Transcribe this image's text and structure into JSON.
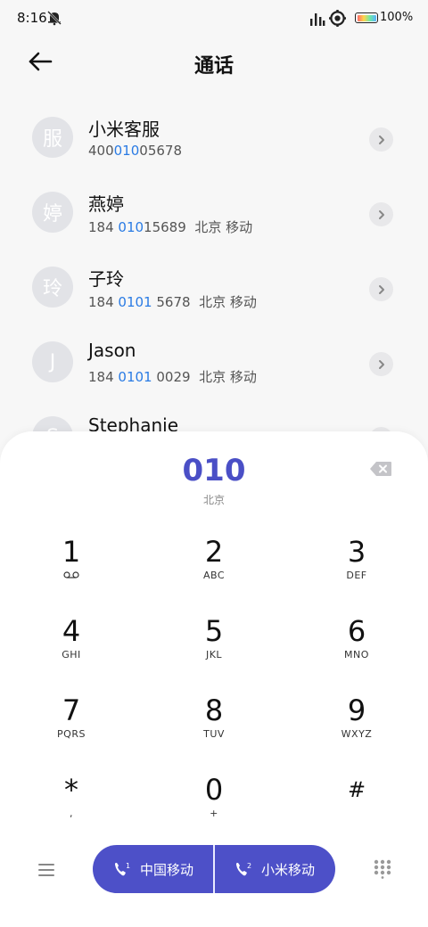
{
  "status_bar": {
    "time": "8:16",
    "battery_percent": "100%",
    "icons": [
      "bell-off-icon",
      "signal-icon",
      "record-ring-icon",
      "battery-icon"
    ]
  },
  "header": {
    "title": "通话",
    "back_icon": "arrow-left-icon"
  },
  "contacts": [
    {
      "avatar": "服",
      "name": "小米客服",
      "num_pre": "400",
      "num_hl": "010",
      "num_post": "05678",
      "location": ""
    },
    {
      "avatar": "婷",
      "name": "燕婷",
      "num_pre": "184 ",
      "num_hl": "010",
      "num_post": "15689",
      "location": "北京 移动"
    },
    {
      "avatar": "玲",
      "name": "子玲",
      "num_pre": "184 ",
      "num_hl": "0101",
      "num_post": " 5678",
      "location": "北京 移动"
    },
    {
      "avatar": "J",
      "name": "Jason",
      "num_pre": "184 ",
      "num_hl": "0101",
      "num_post": " 0029",
      "location": "北京 移动"
    },
    {
      "avatar": "S",
      "name": "Stephanie",
      "num_pre": "",
      "num_hl": "",
      "num_post": "",
      "location": ""
    }
  ],
  "dialer": {
    "dialed_number": "010",
    "dialed_location": "北京",
    "keys": [
      {
        "digit": "1",
        "letters": ""
      },
      {
        "digit": "2",
        "letters": "ABC"
      },
      {
        "digit": "3",
        "letters": "DEF"
      },
      {
        "digit": "4",
        "letters": "GHI"
      },
      {
        "digit": "5",
        "letters": "JKL"
      },
      {
        "digit": "6",
        "letters": "MNO"
      },
      {
        "digit": "7",
        "letters": "PQRS"
      },
      {
        "digit": "8",
        "letters": "TUV"
      },
      {
        "digit": "9",
        "letters": "WXYZ"
      },
      {
        "digit": "*",
        "letters": ","
      },
      {
        "digit": "0",
        "letters": "+"
      },
      {
        "digit": "#",
        "letters": ""
      }
    ],
    "sim1_label": "中国移动",
    "sim2_label": "小米移动",
    "sim1_badge": "1",
    "sim2_badge": "2"
  },
  "colors": {
    "accent": "#4d50c8",
    "highlight": "#2a7be4",
    "avatar_bg": "#e2e3e7"
  }
}
